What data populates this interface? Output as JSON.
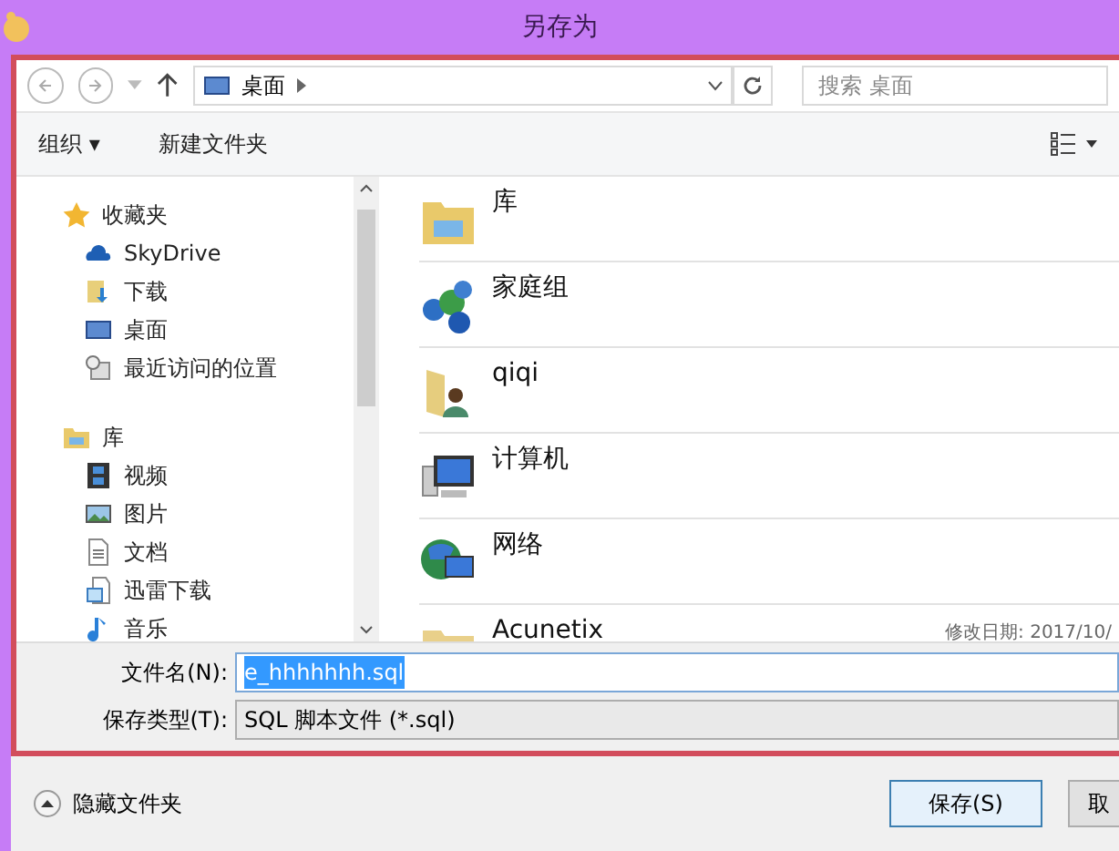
{
  "window": {
    "title": "另存为"
  },
  "nav": {
    "location": "桌面",
    "search_placeholder": "搜索 桌面"
  },
  "toolbar": {
    "organize": "组织 ▾",
    "new_folder": "新建文件夹"
  },
  "sidebar": {
    "groups": [
      {
        "label": "收藏夹",
        "children": [
          {
            "label": "SkyDrive"
          },
          {
            "label": "下载"
          },
          {
            "label": "桌面"
          },
          {
            "label": "最近访问的位置"
          }
        ]
      },
      {
        "label": "库",
        "children": [
          {
            "label": "视频"
          },
          {
            "label": "图片"
          },
          {
            "label": "文档"
          },
          {
            "label": "迅雷下载"
          },
          {
            "label": "音乐"
          }
        ]
      }
    ]
  },
  "items": [
    {
      "name": "库"
    },
    {
      "name": "家庭组"
    },
    {
      "name": "qiqi"
    },
    {
      "name": "计算机"
    },
    {
      "name": "网络"
    },
    {
      "name": "Acunetix",
      "detail": "修改日期: 2017/10/"
    }
  ],
  "filename": {
    "label": "文件名(N):",
    "value": "e_hhhhhhh.sql",
    "text_selected": true
  },
  "filetype": {
    "label": "保存类型(T):",
    "value": "SQL 脚本文件 (*.sql)"
  },
  "footer": {
    "toggle": "隐藏文件夹",
    "save": "保存(S)",
    "cancel": "取"
  }
}
